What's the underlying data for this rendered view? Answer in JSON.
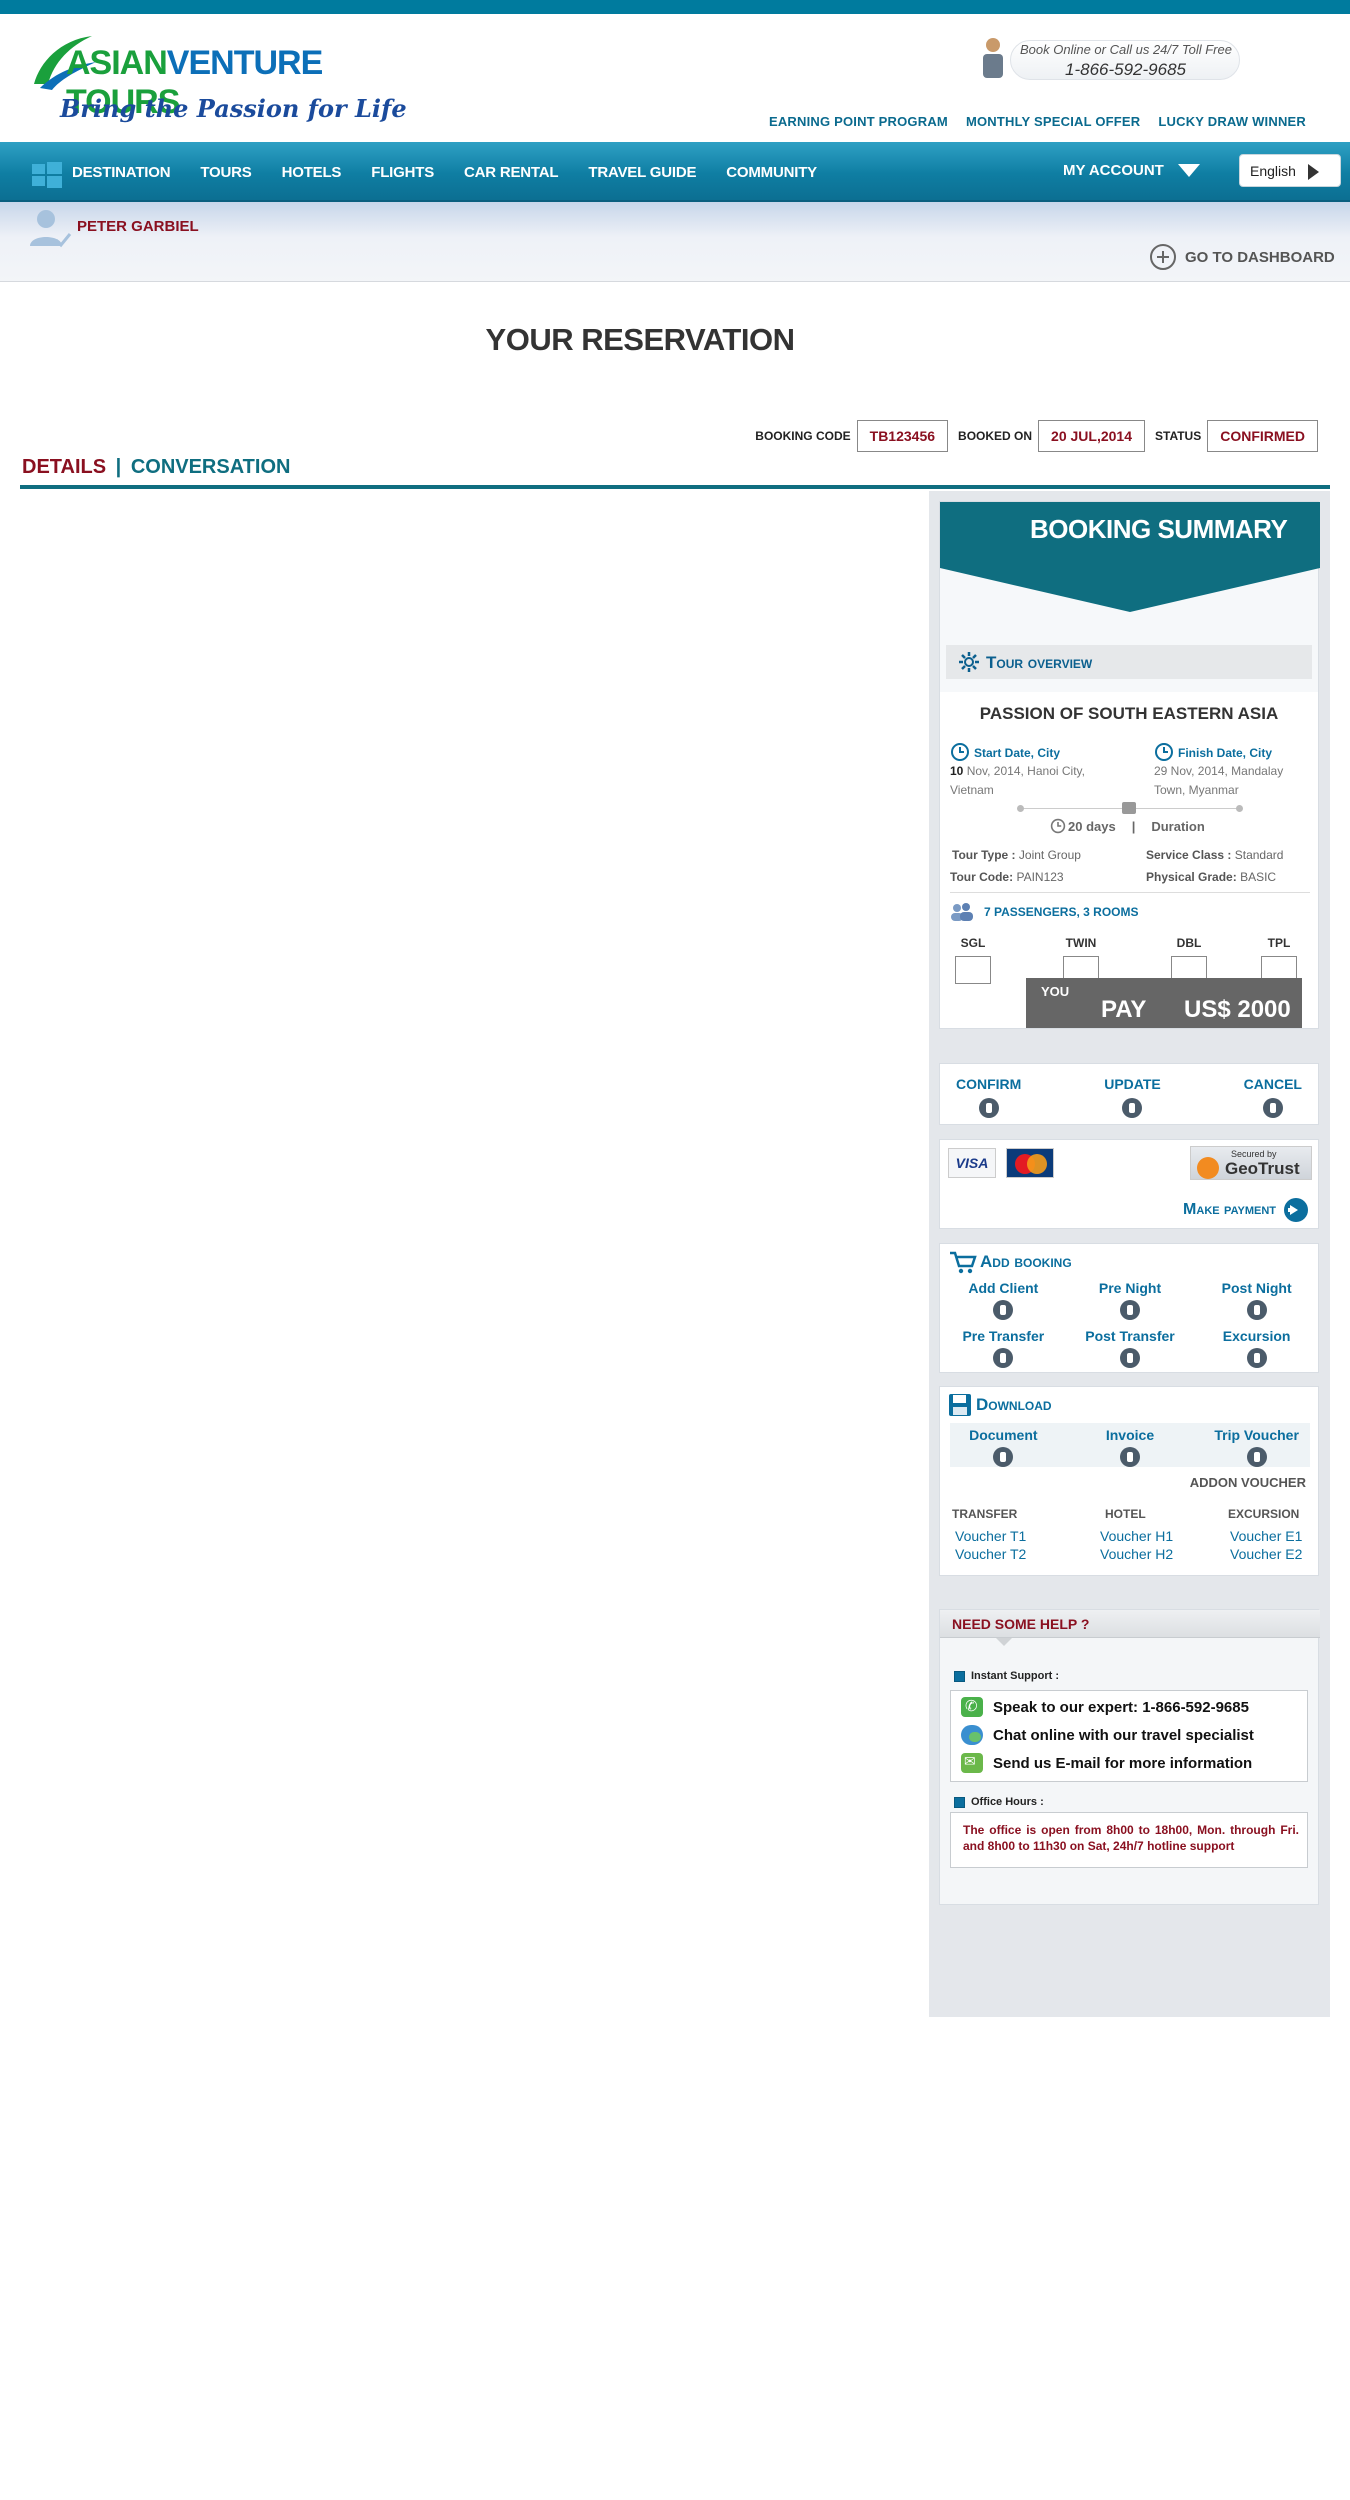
{
  "brand": {
    "name_a": "ASIAN",
    "name_b": "VENTURE",
    "name_c": "TOURS",
    "tagline": "Bring the Passion for Life",
    "call_line1": "Book Online or Call us 24/7 Toll Free",
    "call_phone": "1-866-592-9685"
  },
  "toplinks": [
    "EARNING POINT PROGRAM",
    "MONTHLY SPECIAL OFFER",
    "LUCKY DRAW  WINNER"
  ],
  "nav": {
    "items": [
      "DESTINATION",
      "TOURS",
      "HOTELS",
      "FLIGHTS",
      "CAR RENTAL",
      "TRAVEL GUIDE",
      "COMMUNITY"
    ],
    "my_account": "MY ACCOUNT",
    "language": "English"
  },
  "user": {
    "name": "PETER GARBIEL",
    "dashboard_label": "GO TO DASHBOARD"
  },
  "page": {
    "title": "YOUR RESERVATION"
  },
  "booking": {
    "code_label": "BOOKING CODE",
    "code": "TB123456",
    "booked_on_label": "BOOKED ON",
    "booked_on": "20 JUL,2014",
    "status_label": "STATUS",
    "status": "CONFIRMED"
  },
  "tabs": {
    "details": "DETAILS",
    "separator": "|",
    "conversation": "CONVERSATION"
  },
  "summary": {
    "title": "BOOKING SUMMARY",
    "overview_title": "Tour overview",
    "tour_name": "PASSION OF SOUTH EASTERN ASIA",
    "start_label": "Start Date, City",
    "start_day": "10",
    "start_rest": " Nov, 2014, Hanoi City,",
    "start_city2": "Vietnam",
    "finish_label": "Finish Date, City",
    "finish_line1": "29  Nov,  2014,  Mandalay",
    "finish_line2": "Town, Myanmar",
    "duration_value": "20 days",
    "duration_sep": "|",
    "duration_label": "Duration",
    "tour_type_label": "Tour Type :",
    "tour_type": "Joint Group",
    "service_class_label": "Service Class :",
    "service_class": "Standard",
    "tour_code_label": "Tour  Code:",
    "tour_code": "PAIN123",
    "physical_grade_label": "Physical Grade:",
    "physical_grade": "BASIC",
    "passengers": "7 PASSENGERS, 3 ROOMS",
    "rooms": [
      "SGL",
      "TWIN",
      "DBL",
      "TPL"
    ],
    "pay_you": "YOU",
    "pay_word": "PAY",
    "pay_amount": "US$ 2000"
  },
  "actions": [
    "CONFIRM",
    "UPDATE",
    "CANCEL"
  ],
  "payment": {
    "visa": "VISA",
    "secured_by": "Secured by",
    "geotrust": "GeoTrust",
    "make_payment": "Make payment"
  },
  "add_booking": {
    "title": "Add booking",
    "items": [
      "Add Client",
      "Pre Night",
      "Post Night",
      "Pre Transfer",
      "Post Transfer",
      "Excursion"
    ]
  },
  "download": {
    "title": "Download",
    "items": [
      "Document",
      "Invoice",
      "Trip Voucher"
    ],
    "addon": "ADDON VOUCHER",
    "transfer_label": "TRANSFER",
    "hotel_label": "HOTEL",
    "excursion_label": "EXCURSION",
    "transfer": [
      "Voucher T1",
      "Voucher T2"
    ],
    "hotel": [
      "Voucher H1",
      "Voucher H2"
    ],
    "excursion": [
      "Voucher E1",
      "Voucher E2"
    ]
  },
  "help": {
    "title": "NEED SOME HELP ?",
    "instant_label": "Instant Support :",
    "speak": "Speak to  our  expert: 1-866-592-9685",
    "chat": "Chat online with our travel specialist",
    "email": "Send us E-mail for more  information",
    "office_label": "Office Hours :",
    "office_text": "The office  is open from 8h00 to 18h00, Mon.  through Fri. and 8h00 to 11h30 on  Sat,  24h/7 hotline  support"
  },
  "colors": {
    "primary": "#0f6e80",
    "nav": "#1a8db2",
    "accent_red": "#8a1020",
    "link": "#0b6e9e",
    "sidebar_bg": "#e4e7eb"
  }
}
